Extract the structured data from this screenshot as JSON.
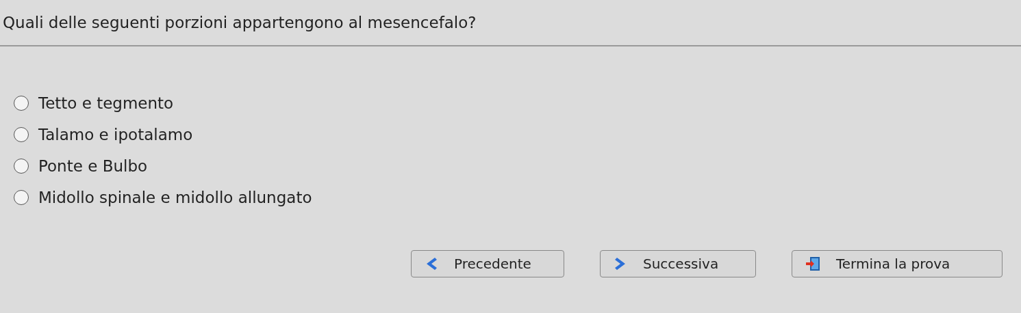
{
  "question": "Quali delle seguenti porzioni appartengono al mesencefalo?",
  "options": [
    {
      "label": "Tetto e tegmento",
      "selected": false
    },
    {
      "label": "Talamo e ipotalamo",
      "selected": false
    },
    {
      "label": "Ponte e Bulbo",
      "selected": false
    },
    {
      "label": "Midollo spinale e midollo allungato",
      "selected": false
    }
  ],
  "buttons": [
    {
      "label": "Precedente",
      "kind": "prev"
    },
    {
      "label": "Successiva",
      "kind": "next"
    },
    {
      "label": "Termina la prova",
      "kind": "exit"
    }
  ]
}
